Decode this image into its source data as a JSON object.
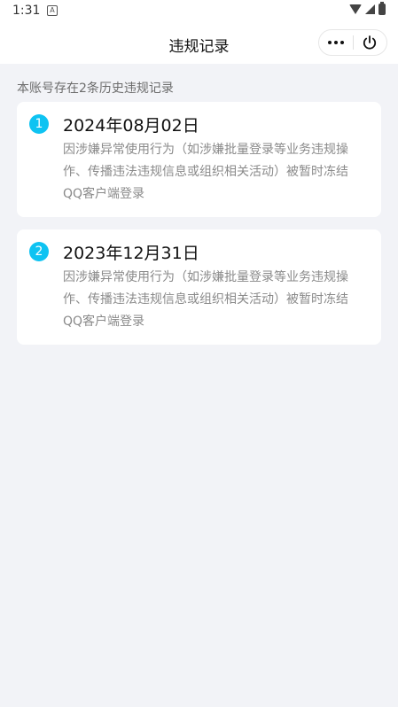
{
  "status_bar": {
    "time": "1:31",
    "notification_icon": "A",
    "icons": [
      "wifi-icon",
      "signal-icon",
      "battery-icon"
    ]
  },
  "nav": {
    "title": "违规记录",
    "more_icon": "more-dots-icon",
    "close_icon": "power-icon"
  },
  "summary": "本账号存在2条历史违规记录",
  "records": [
    {
      "index": "1",
      "date": "2024年08月02日",
      "description": "因涉嫌异常使用行为（如涉嫌批量登录等业务违规操作、传播违法违规信息或组织相关活动）被暂时冻结QQ客户端登录"
    },
    {
      "index": "2",
      "date": "2023年12月31日",
      "description": "因涉嫌异常使用行为（如涉嫌批量登录等业务违规操作、传播违法违规信息或组织相关活动）被暂时冻结QQ客户端登录"
    }
  ],
  "colors": {
    "accent": "#0ec3f2",
    "background": "#f2f3f7",
    "card": "#ffffff",
    "muted_text": "#8a8a8a"
  }
}
